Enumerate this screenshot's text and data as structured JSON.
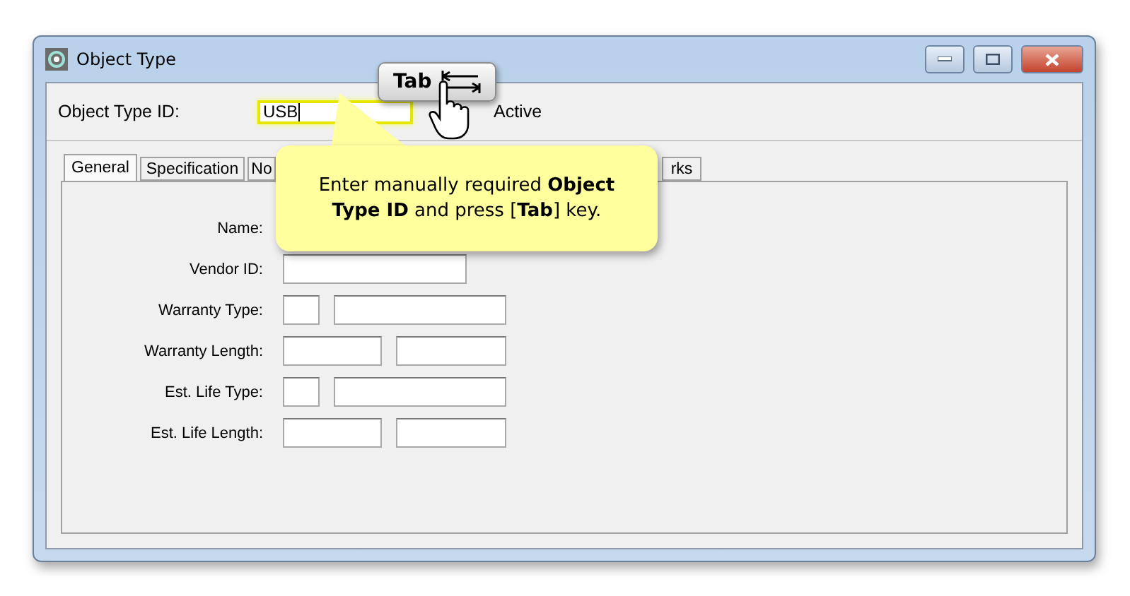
{
  "window": {
    "title": "Object Type"
  },
  "header": {
    "id_label": "Object Type ID:",
    "id_value": "USB",
    "active_label": "Active"
  },
  "tabs": [
    {
      "label": "General",
      "selected": true
    },
    {
      "label": "Specification",
      "selected": false
    },
    {
      "label": "No",
      "selected": false
    },
    {
      "label": "rks",
      "selected": false
    }
  ],
  "fields": [
    {
      "label": "Name:",
      "kind": "hidden"
    },
    {
      "label": "Vendor ID:",
      "kind": "single"
    },
    {
      "label": "Warranty Type:",
      "kind": "code"
    },
    {
      "label": "Warranty Length:",
      "kind": "pair"
    },
    {
      "label": "Est. Life Type:",
      "kind": "code"
    },
    {
      "label": "Est. Life Length:",
      "kind": "pair"
    }
  ],
  "callout": {
    "text": "Enter manually required **Object Type ID** and press [**Tab**] key."
  },
  "key_hint": {
    "label": "Tab"
  }
}
